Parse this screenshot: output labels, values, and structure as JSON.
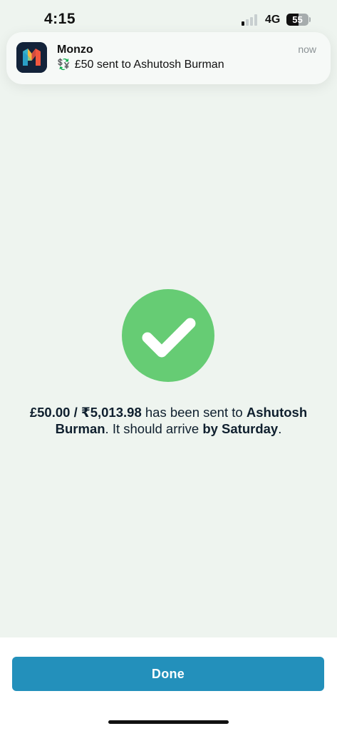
{
  "status_bar": {
    "time": "4:15",
    "network": "4G",
    "battery_percent": "55",
    "battery_level": 0.55,
    "signal_bars_active": 1,
    "signal_bars_total": 4
  },
  "notification": {
    "app_name": "Monzo",
    "emoji": "💱",
    "message": "£50 sent to Ashutosh Burman",
    "time": "now",
    "app_icon": "monzo-logo"
  },
  "confirmation": {
    "icon": "checkmark-icon",
    "amount": "£50.00 / ₹5,013.98",
    "text_part1": " has been sent to ",
    "recipient": "Ashutosh Burman",
    "text_part2": ". It should arrive ",
    "arrival": "by Saturday",
    "text_part3": "."
  },
  "actions": {
    "done_label": "Done"
  },
  "colors": {
    "success_green": "#66cc74",
    "button_blue": "#2390bb",
    "background": "#eef4ef"
  }
}
